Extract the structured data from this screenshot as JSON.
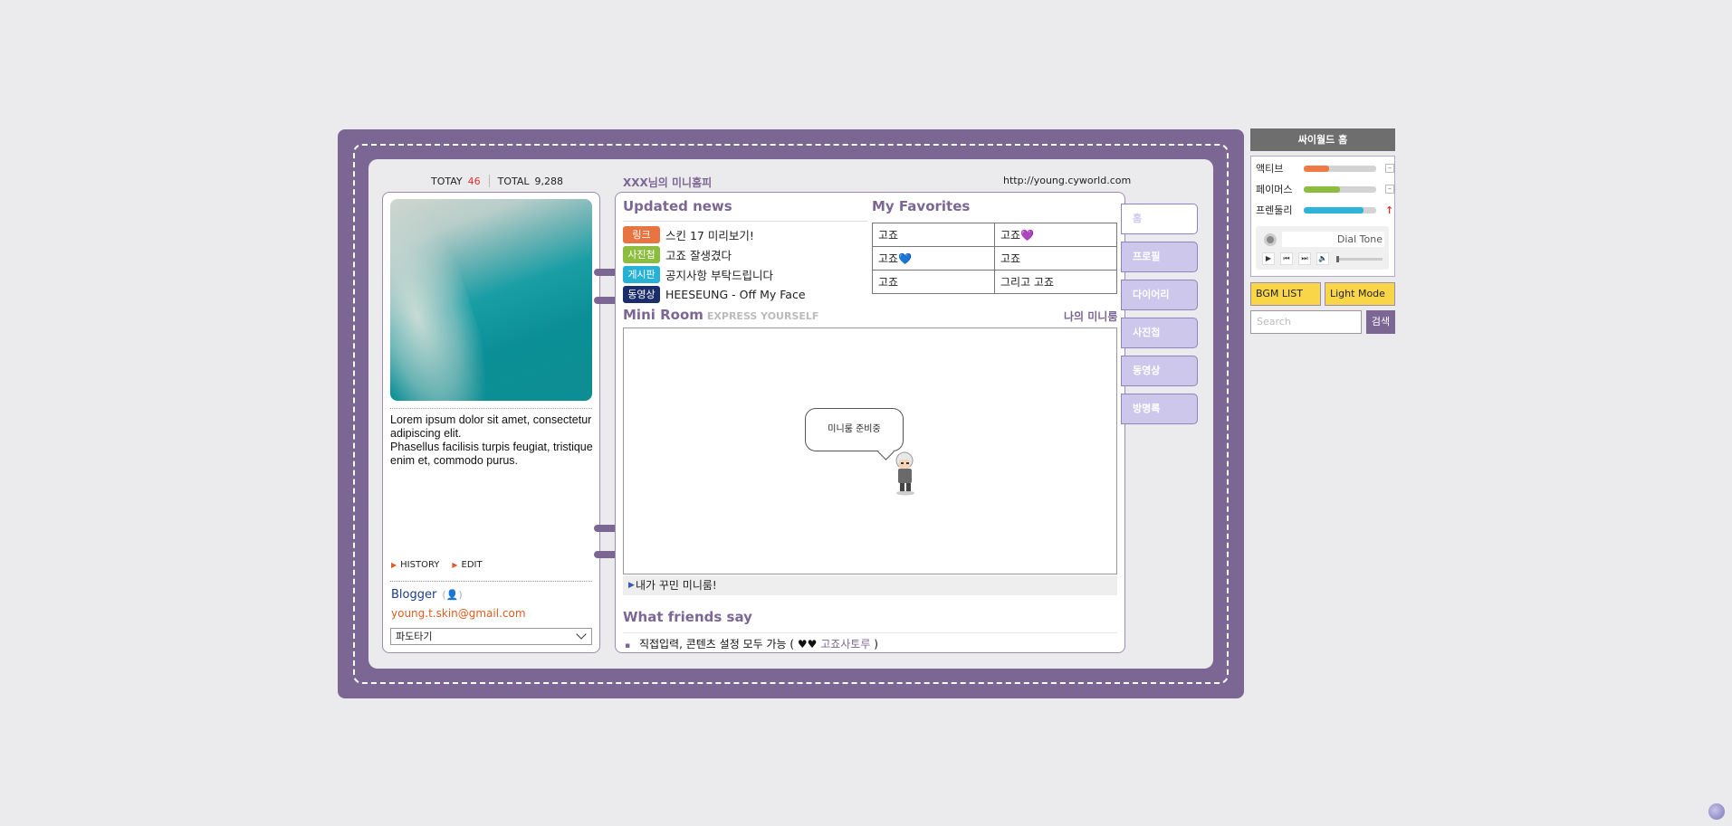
{
  "counter": {
    "today_label": "TOTAY",
    "today_value": "46",
    "total_label": "TOTAL",
    "total_value": "9,288"
  },
  "profile": {
    "bio": "Lorem ipsum dolor sit amet, consectetur adipiscing elit.\nPhasellus facilisis turpis feugiat, tristique enim et, commodo purus.",
    "links": [
      "HISTORY",
      "EDIT"
    ],
    "blogger": "Blogger",
    "email": "young.t.skin@gmail.com",
    "select_value": "파도타기"
  },
  "header": {
    "title": "XXX님의 미니홈피",
    "url": "http://young.cyworld.com"
  },
  "updated_news": {
    "title": "Updated news",
    "items": [
      {
        "tag": "링크",
        "color": "#e87541",
        "text": "스킨 17 미리보기!"
      },
      {
        "tag": "사진첩",
        "color": "#8cbd3f",
        "text": "고죠 잘생겼다"
      },
      {
        "tag": "게시판",
        "color": "#27b2d5",
        "text": "공지사항 부탁드립니다"
      },
      {
        "tag": "동영상",
        "color": "#1c2d6b",
        "text": "HEESEUNG - Off My Face"
      }
    ]
  },
  "favorites": {
    "title": "My Favorites",
    "rows": [
      [
        "고죠",
        "고죠💜"
      ],
      [
        "고죠💙",
        "고죠"
      ],
      [
        "고죠",
        "그리고 고죠"
      ]
    ]
  },
  "mini_room": {
    "title": "Mini Room",
    "subtitle": "EXPRESS YOURSELF",
    "link": "나의 미니룸",
    "bubble": "미니룸 준비중",
    "caption": "내가 꾸민 미니룸!"
  },
  "friends": {
    "title": "What friends say",
    "comment": "직접입력, 콘텐츠 설정 모두 가능 ( ♥♥",
    "name": "고죠사토루",
    "close": " )"
  },
  "tabs": [
    "홈",
    "프로필",
    "다이어리",
    "사진첩",
    "동영상",
    "방명록"
  ],
  "sidebar": {
    "title": "싸이월드 홈",
    "stats": [
      {
        "label": "액티브",
        "value": 0.35,
        "color": "#ef7a46",
        "action": "–"
      },
      {
        "label": "페이머스",
        "value": 0.5,
        "color": "#8cbd3f",
        "action": "–"
      },
      {
        "label": "프렌둘리",
        "value": 0.82,
        "color": "#2eb4d8",
        "action": "↑"
      }
    ],
    "player_track": "Dial Tone",
    "bgm_button": "BGM LIST",
    "mode_button": "Light Mode",
    "search_placeholder": "Search",
    "search_button": "검색"
  }
}
